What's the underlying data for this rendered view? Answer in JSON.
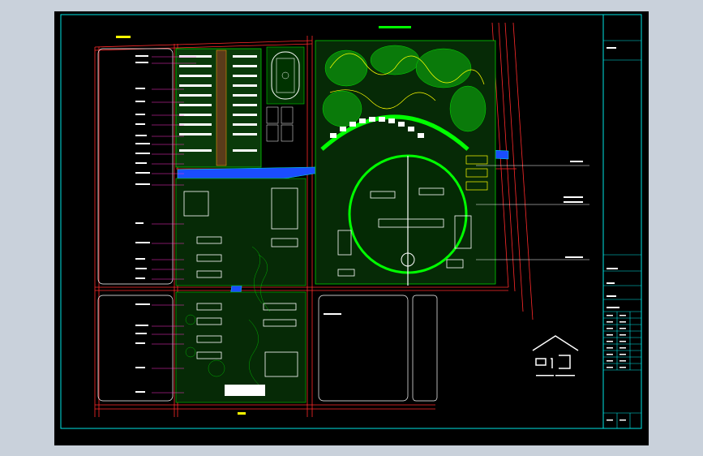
{
  "window": {
    "background": "#c9d1db",
    "canvas_background": "#000000"
  },
  "colors": {
    "frame": "#00e5e5",
    "road": "#ff2a2a",
    "green": "#00d000",
    "water": "#1a4dff",
    "building": "#ffffff",
    "leader": "#ff33cc",
    "magenta": "#ff00ff",
    "yellow": "#ffff00"
  },
  "labels": {
    "left_callouts": [
      "",
      "",
      "",
      "",
      "",
      "",
      "",
      "",
      "",
      "",
      "",
      "",
      "",
      "",
      "",
      "",
      "",
      "",
      "",
      "",
      "",
      ""
    ],
    "right_callouts": [
      "",
      "",
      ""
    ],
    "bottom_gate": "",
    "title_block_rows": [
      "",
      "",
      "",
      "",
      "",
      "",
      ""
    ]
  },
  "icons": {
    "logo": "house-outline-logo-icon"
  }
}
